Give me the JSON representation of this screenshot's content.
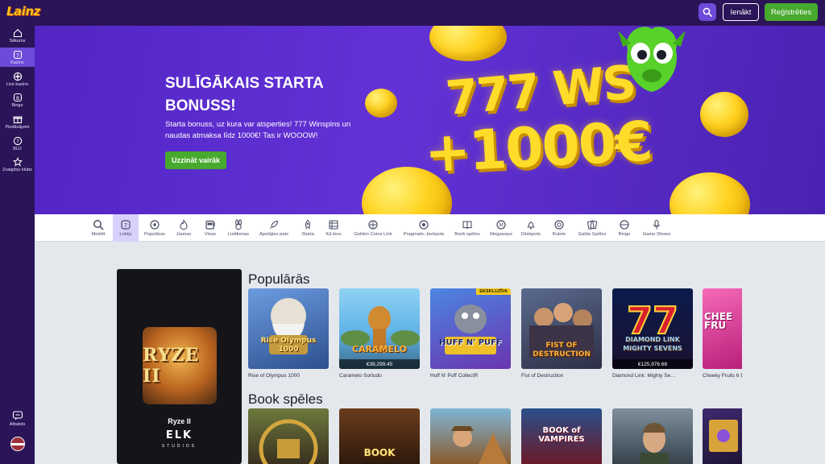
{
  "app": {
    "logo": "Lainz",
    "login_label": "Ienākt",
    "register_label": "Reģistrēties",
    "brand_color": "#2b1458",
    "accent_color": "#6d4ad8",
    "cta_color": "#47a92d"
  },
  "sidebar": {
    "items": [
      {
        "label": "Sākums",
        "icon": "home-icon"
      },
      {
        "label": "Kazino",
        "icon": "slot-icon"
      },
      {
        "label": "Live kazino",
        "icon": "roulette-icon"
      },
      {
        "label": "Bingo",
        "icon": "bingo-icon"
      },
      {
        "label": "Piedāvājumi",
        "icon": "gift-icon"
      },
      {
        "label": "BUJ",
        "icon": "help-icon"
      },
      {
        "label": "Zvaigžņu klubs",
        "icon": "star-icon"
      }
    ],
    "support_label": "Atbalsts",
    "language": "LV"
  },
  "hero": {
    "title": "SULĪGĀKAIS STARTA BONUSS!",
    "text": "Starta bonuss, uz kura var atsperties! 777 Winspins un naudas atmaksa līdz 1000€! Tas ir WOOOW!",
    "cta": "Uzzināt vairāk",
    "bonus_line1": "777 WS",
    "bonus_line2": "+1000€"
  },
  "categories": [
    {
      "label": "Meklēt",
      "icon": "search-icon"
    },
    {
      "label": "Lobijs",
      "icon": "lobby-icon"
    },
    {
      "label": "Populāras",
      "icon": "popular-icon"
    },
    {
      "label": "Jaunas",
      "icon": "flame-icon"
    },
    {
      "label": "Visas",
      "icon": "slot-machine-icon"
    },
    {
      "label": "Lieldienas",
      "icon": "bunny-icon"
    },
    {
      "label": "Apstājies pats",
      "icon": "rocket-icon"
    },
    {
      "label": "Starta",
      "icon": "rocket-start-icon"
    },
    {
      "label": "Kā kino",
      "icon": "film-icon"
    },
    {
      "label": "Golden Coins Link",
      "icon": "coin-icon"
    },
    {
      "label": "Pragmatic Jackpots",
      "icon": "jackpot-icon"
    },
    {
      "label": "Book spēles",
      "icon": "book-icon"
    },
    {
      "label": "Megaways",
      "icon": "megaways-icon"
    },
    {
      "label": "Džekpots",
      "icon": "bell-icon"
    },
    {
      "label": "Rulete",
      "icon": "roulette-icon"
    },
    {
      "label": "Galda Spēles",
      "icon": "cards-icon"
    },
    {
      "label": "Bingo",
      "icon": "bingo-icon"
    },
    {
      "label": "Game Shows",
      "icon": "mic-icon"
    }
  ],
  "featured": {
    "title": "Ryze II",
    "logo_text": "RYZE II",
    "brand": "ELK",
    "brand_sub": "STUDIOS"
  },
  "sections": [
    {
      "title": "Populārās",
      "games": [
        {
          "name": "Rise of Olympus 1000",
          "art": "Rise Olympus 1000",
          "colors": [
            "#4a7bc4",
            "#c6a35c"
          ],
          "jackpot": ""
        },
        {
          "name": "Caramelo Sortudo",
          "art": "CARAMELO",
          "colors": [
            "#5fb3e6",
            "#d08a2f"
          ],
          "jackpot": "€39,299.45"
        },
        {
          "name": "Huff N' Puff CollectR",
          "art": "HUFF N' PUFF",
          "colors": [
            "#3b6fd1",
            "#7a3fb8"
          ],
          "jackpot": "",
          "badge": "EKSKLUZĪVA"
        },
        {
          "name": "Fist of Destruction",
          "art": "FIST OF DESTRUCTION",
          "colors": [
            "#3d4a6e",
            "#c4582a"
          ],
          "jackpot": ""
        },
        {
          "name": "Diamond Link: Mighty Se…",
          "art": "DIAMOND LINK MIGHTY SEVENS",
          "colors": [
            "#0c1b4d",
            "#b3122b"
          ],
          "jackpot": "€125,976.68"
        },
        {
          "name": "Cheeky Fruits 6 D…",
          "art": "CHEE FRU",
          "colors": [
            "#b81f7a",
            "#f56ab7"
          ],
          "jackpot": ""
        }
      ]
    },
    {
      "title": "Book spēles",
      "games": [
        {
          "art": "",
          "colors": [
            "#3a5a2c",
            "#c99c3a"
          ]
        },
        {
          "art": "BOOK",
          "colors": [
            "#4a2a18",
            "#d19a3f"
          ]
        },
        {
          "art": "",
          "colors": [
            "#2f6b8f",
            "#c48a3a"
          ]
        },
        {
          "art": "BOOK of VAMPIRES",
          "colors": [
            "#1d3b6e",
            "#c23a3a"
          ]
        },
        {
          "art": "",
          "colors": [
            "#3d5060",
            "#8d9fab"
          ]
        },
        {
          "art": "",
          "colors": [
            "#2a1d4a",
            "#d8a43a"
          ]
        }
      ]
    }
  ]
}
